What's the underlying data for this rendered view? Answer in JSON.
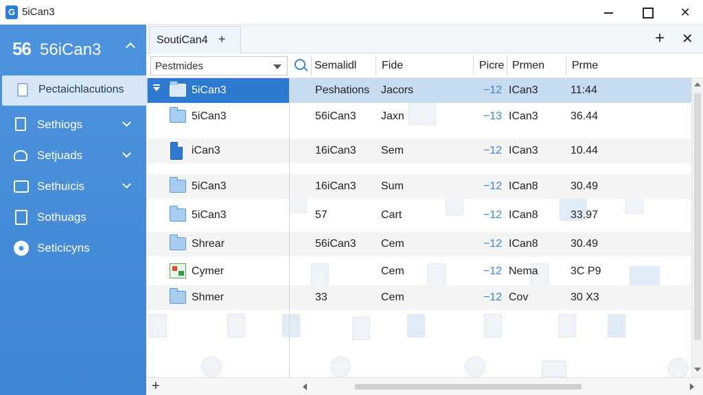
{
  "window": {
    "title": "5iCan3",
    "logo_text": "G"
  },
  "sidebar": {
    "header_icon_text": "56",
    "header_label": "56iCan3",
    "items": [
      {
        "label": "Pectaichlacutions",
        "icon": "document-icon"
      },
      {
        "label": "Sethiogs",
        "icon": "file-icon"
      },
      {
        "label": "Setjuads",
        "icon": "users-icon"
      },
      {
        "label": "Sethuicis",
        "icon": "calendar-icon"
      },
      {
        "label": "Sothuags",
        "icon": "clipboard-icon"
      },
      {
        "label": "Seticicyns",
        "icon": "gear-icon"
      }
    ]
  },
  "tabs": [
    {
      "label": "SoutiCan4",
      "add": "+"
    }
  ],
  "toolbar": {
    "plus": "+",
    "close": "✕"
  },
  "filter": {
    "value": "Pestmides"
  },
  "columns": [
    "Semalidl",
    "Fide",
    "Picre",
    "Prmen",
    "Prme"
  ],
  "rows": [
    {
      "name": "5iCan3",
      "icon": "folder-icon",
      "c1": "Peshations",
      "c2": "Jacors",
      "c3": "−12",
      "c4": "ICan3",
      "c5": "11:44",
      "selected": true
    },
    {
      "name": "5iCan3",
      "icon": "folder-icon",
      "c1": "56iCan3",
      "c2": "Jaxn",
      "c3": "−13",
      "c4": "ICan3",
      "c5": "36.44"
    },
    {
      "name": "iCan3",
      "icon": "file-icon",
      "c1": "16iCan3",
      "c2": "Sem",
      "c3": "−12",
      "c4": "ICan3",
      "c5": "10.44"
    },
    {
      "name": "5iCan3",
      "icon": "folder-icon",
      "c1": "16iCan3",
      "c2": "Sum",
      "c3": "−12",
      "c4": "ICan8",
      "c5": "30.49"
    },
    {
      "name": "5iCan3",
      "icon": "folder-icon",
      "c1": "57",
      "c2": "Cart",
      "c3": "−12",
      "c4": "ICan8",
      "c5": "33.97"
    },
    {
      "name": "Shrear",
      "icon": "folder-icon",
      "c1": "56iCan3",
      "c2": "Cem",
      "c3": "−12",
      "c4": "ICan8",
      "c5": "30.49"
    },
    {
      "name": "Cymer",
      "icon": "image-icon",
      "c1": "",
      "c2": "Cem",
      "c3": "−12",
      "c4": "Nema",
      "c5": "3C P9"
    },
    {
      "name": "Shmer",
      "icon": "folder-icon",
      "c1": "33",
      "c2": "Cem",
      "c3": "−12",
      "c4": "Cov",
      "c5": "30 X3"
    }
  ],
  "bottom": {
    "plus": "+"
  }
}
